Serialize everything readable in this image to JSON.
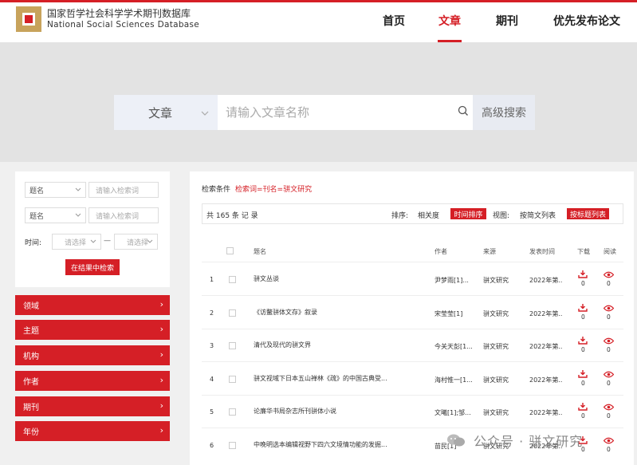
{
  "brand": {
    "name_cn": "国家哲学社会科学学术期刊数据库",
    "name_en": "National Social Sciences Database"
  },
  "nav": {
    "items": [
      {
        "label": "首页",
        "active": false
      },
      {
        "label": "文章",
        "active": true
      },
      {
        "label": "期刊",
        "active": false
      },
      {
        "label": "优先发布论文",
        "active": false
      }
    ]
  },
  "search": {
    "type": "文章",
    "placeholder": "请输入文章名称",
    "advanced_label": "高级搜索"
  },
  "filter": {
    "field1": "题名",
    "field1_placeholder": "请输入检索词",
    "field2": "题名",
    "field2_placeholder": "请输入检索词",
    "time_label": "时间:",
    "time_from": "请选择",
    "time_to": "请选择",
    "dash": "—",
    "refine_label": "在结果中检索"
  },
  "categories": [
    "领域",
    "主题",
    "机构",
    "作者",
    "期刊",
    "年份"
  ],
  "results": {
    "condition_label": "检索条件",
    "condition_value": "检索词=刊名=骈文研究",
    "total_text": "共 165 条 记 录",
    "sort_label": "排序:",
    "sort_relevance": "相关度",
    "sort_time": "时间排序",
    "view_label": "视图:",
    "view_list": "按简文列表",
    "view_title": "按标题列表",
    "headers": {
      "title": "题名",
      "author": "作者",
      "source": "来源",
      "date": "发表时间",
      "download": "下载",
      "read": "阅读"
    },
    "rows": [
      {
        "no": "1",
        "title": "骈文丛谈",
        "author": "尹梦雨[1]...",
        "source": "骈文研究",
        "date": "2022年第...",
        "downloads": "0",
        "reads": "0"
      },
      {
        "no": "2",
        "title": "《访鳌骈体文存》叙录",
        "author": "宋莹莹[1]",
        "source": "骈文研究",
        "date": "2022年第...",
        "downloads": "0",
        "reads": "0"
      },
      {
        "no": "3",
        "title": "清代及现代的骈文界",
        "author": "今关天彭[1...",
        "source": "骈文研究",
        "date": "2022年第...",
        "downloads": "0",
        "reads": "0"
      },
      {
        "no": "4",
        "title": "骈文视域下日本五山禅林《疏》的中国古典受...",
        "author": "海村惟一[1...",
        "source": "骈文研究",
        "date": "2022年第...",
        "downloads": "0",
        "reads": "0"
      },
      {
        "no": "5",
        "title": "论廉华书局杂志所刊骈体小说",
        "author": "文曦[1];邹...",
        "source": "骈文研究",
        "date": "2022年第...",
        "downloads": "0",
        "reads": "0"
      },
      {
        "no": "6",
        "title": "中晚明选本编辑视野下四六文境情功能的发掘...",
        "author": "苗民[1]",
        "source": "骈文研究",
        "date": "2022年第...",
        "downloads": "0",
        "reads": "0"
      }
    ]
  },
  "watermark": "公众号 · 骈文研究",
  "colors": {
    "accent": "#d51f26",
    "gold": "#c8a35c"
  }
}
